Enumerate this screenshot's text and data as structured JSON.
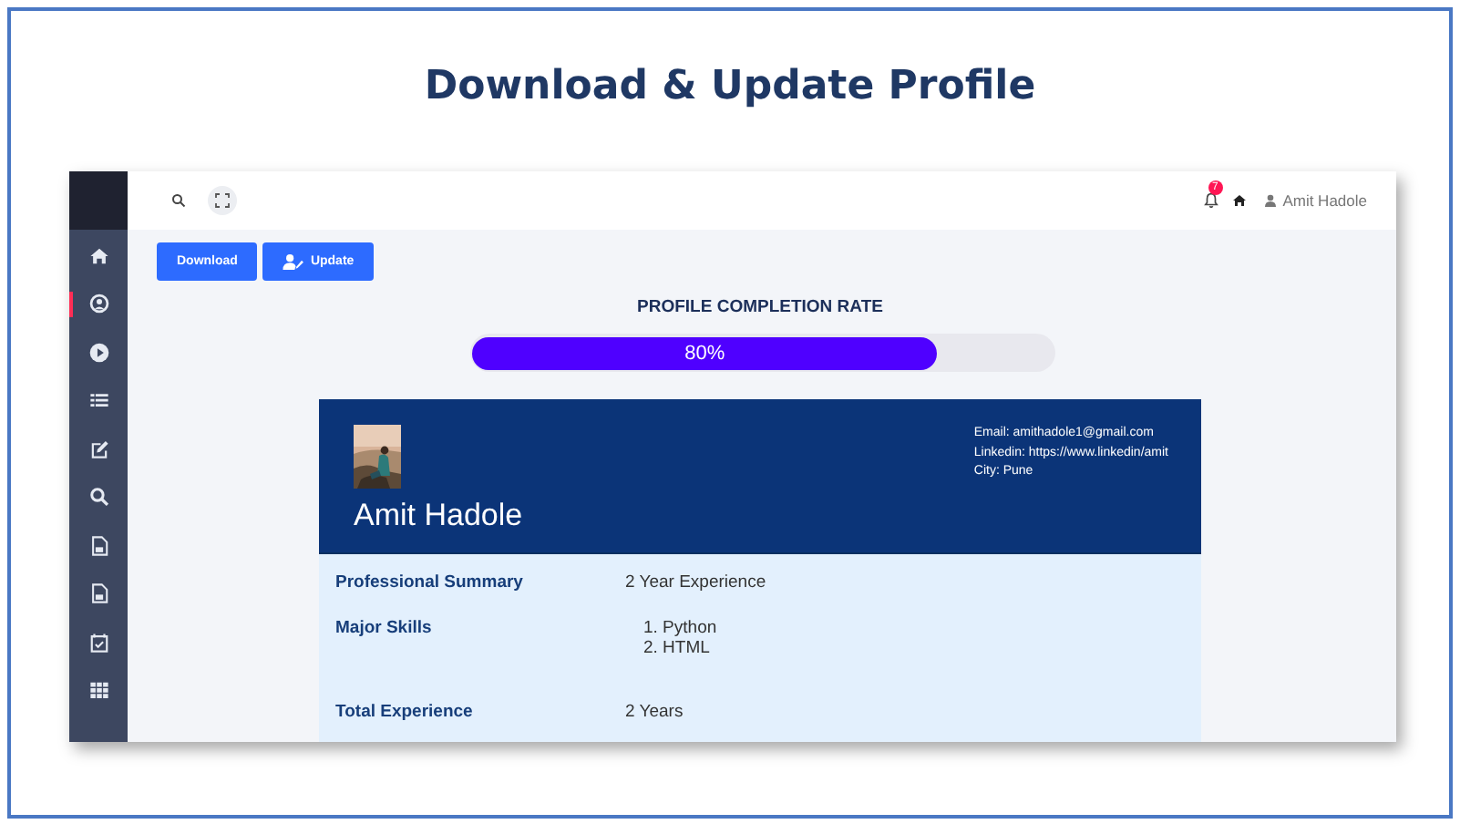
{
  "title": "Download & Update Profile",
  "sidebar": {
    "items": [
      {
        "selected": false
      },
      {
        "selected": true
      },
      {
        "selected": false
      },
      {
        "selected": false
      },
      {
        "selected": false
      },
      {
        "selected": false
      },
      {
        "selected": false
      },
      {
        "selected": false
      },
      {
        "selected": false
      },
      {
        "selected": false
      }
    ]
  },
  "topbar": {
    "notifications": "7",
    "user": "Amit Hadole"
  },
  "buttons": [
    {
      "label": "Download"
    },
    {
      "label": "Update"
    }
  ],
  "progress": {
    "title": "PROFILE COMPLETION RATE",
    "level": 0.8,
    "reading": "80%"
  },
  "profile": {
    "name": "Amit Hadole",
    "contacts": [
      "Email: amithadole1@gmail.com",
      "Linkedin: https://www.linkedin/amit",
      "City: Pune"
    ],
    "rows": [
      {
        "label": "Professional Summary",
        "kind": "text",
        "value": "2 Year Experience"
      },
      {
        "label": "Major Skills",
        "kind": "list",
        "items": [
          "1. Python",
          "2. HTML"
        ]
      },
      {
        "label": "Total Experience",
        "kind": "text",
        "value": "2 Years"
      }
    ]
  }
}
